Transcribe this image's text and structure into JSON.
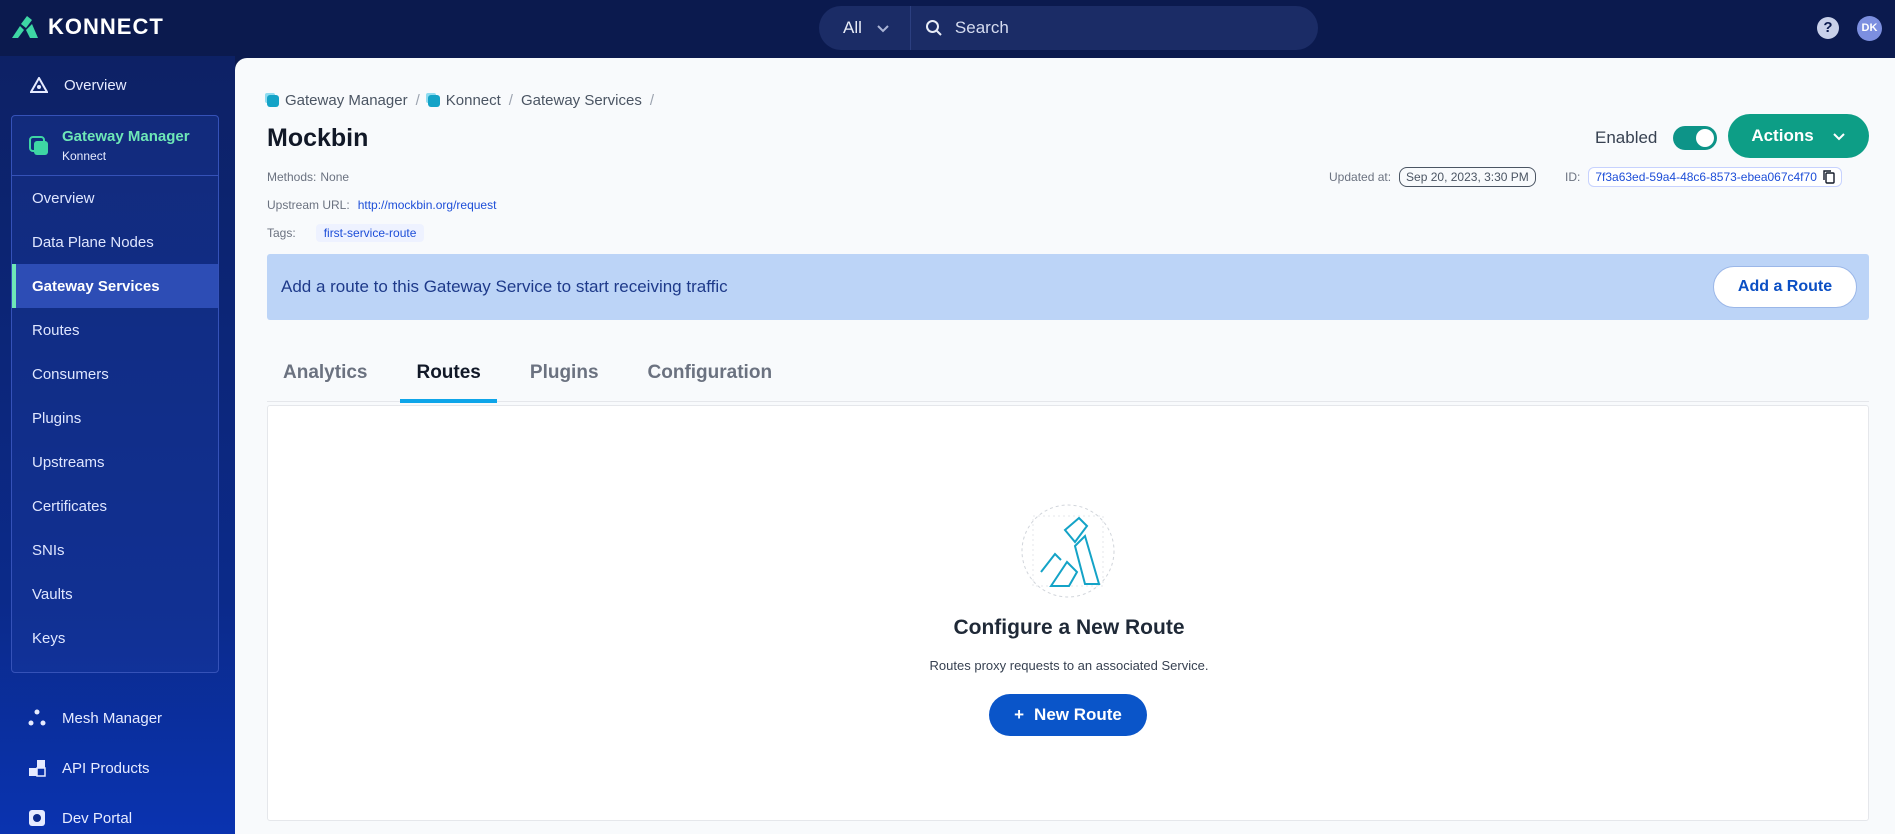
{
  "app": {
    "brand": "KONNECT"
  },
  "search": {
    "scope": "All",
    "placeholder": "Search"
  },
  "header": {
    "help": "?",
    "avatar": "DK"
  },
  "sidebar": {
    "overview": "Overview",
    "gateway_manager": {
      "title": "Gateway Manager",
      "subtitle": "Konnect"
    },
    "items": [
      {
        "label": "Overview"
      },
      {
        "label": "Data Plane Nodes"
      },
      {
        "label": "Gateway Services"
      },
      {
        "label": "Routes"
      },
      {
        "label": "Consumers"
      },
      {
        "label": "Plugins"
      },
      {
        "label": "Upstreams"
      },
      {
        "label": "Certificates"
      },
      {
        "label": "SNIs"
      },
      {
        "label": "Vaults"
      },
      {
        "label": "Keys"
      }
    ],
    "active_item": "Gateway Services",
    "bottom": [
      {
        "label": "Mesh Manager"
      },
      {
        "label": "API Products"
      },
      {
        "label": "Dev Portal"
      }
    ]
  },
  "breadcrumb": [
    {
      "label": "Gateway Manager"
    },
    {
      "label": "Konnect"
    },
    {
      "label": "Gateway Services"
    }
  ],
  "breadcrumb_sep": "/",
  "page": {
    "title": "Mockbin",
    "enabled_label": "Enabled",
    "actions_label": "Actions",
    "methods_label": "Methods:",
    "methods_value": "None",
    "upstream_label": "Upstream URL:",
    "upstream_value": "http://mockbin.org/request",
    "tags_label": "Tags:",
    "tag": "first-service-route",
    "updated_label": "Updated at:",
    "updated_value": "Sep 20, 2023, 3:30 PM",
    "id_label": "ID:",
    "id_value": "7f3a63ed-59a4-48c6-8573-ebea067c4f70"
  },
  "banner": {
    "text": "Add a route to this Gateway Service to start receiving traffic",
    "button": "Add a Route"
  },
  "tabs": [
    {
      "label": "Analytics"
    },
    {
      "label": "Routes"
    },
    {
      "label": "Plugins"
    },
    {
      "label": "Configuration"
    }
  ],
  "active_tab": "Routes",
  "empty_state": {
    "title": "Configure a New Route",
    "description": "Routes proxy requests to an associated Service.",
    "button": "New Route",
    "button_icon": "+"
  },
  "colors": {
    "accent": "#0d9e86",
    "primary": "#0a55c9",
    "nav_bg": "#0b1a4e",
    "active_nav": "#6ee7b7"
  }
}
